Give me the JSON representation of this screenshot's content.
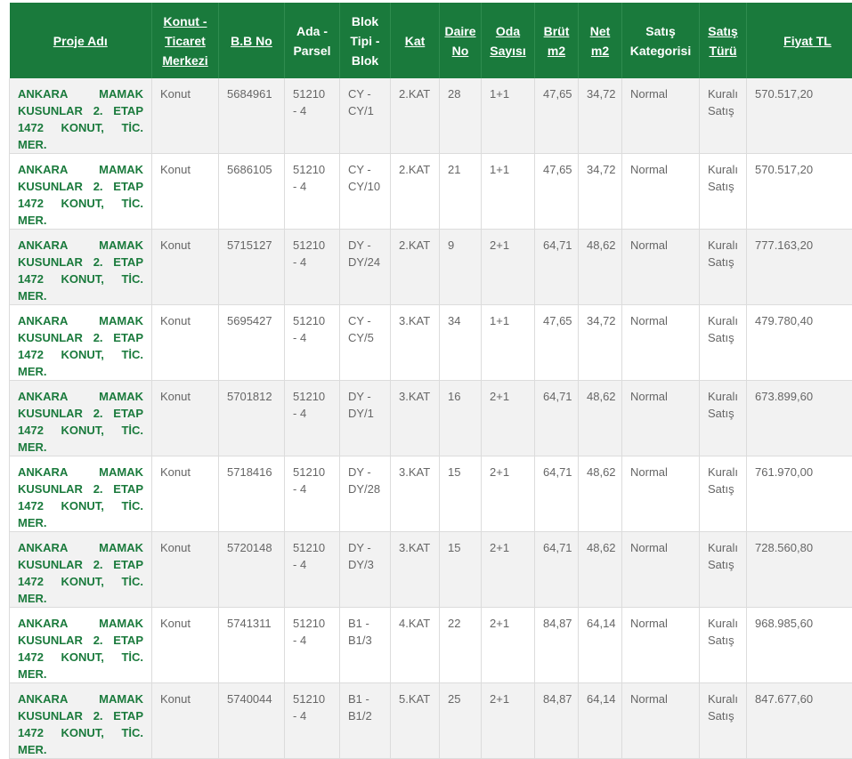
{
  "table": {
    "headers": [
      {
        "key": "proje",
        "label": "Proje Adı",
        "sortable": true
      },
      {
        "key": "konut",
        "label": "Konut - Ticaret Merkezi",
        "sortable": true
      },
      {
        "key": "bb",
        "label": "B.B No",
        "sortable": true
      },
      {
        "key": "ada",
        "label": "Ada - Parsel",
        "sortable": false
      },
      {
        "key": "blok",
        "label": "Blok Tipi - Blok",
        "sortable": false
      },
      {
        "key": "kat",
        "label": "Kat",
        "sortable": true
      },
      {
        "key": "daire",
        "label": "Daire No",
        "sortable": true
      },
      {
        "key": "oda",
        "label": "Oda Sayısı",
        "sortable": true
      },
      {
        "key": "brut",
        "label": "Brüt m2",
        "sortable": true
      },
      {
        "key": "net",
        "label": "Net m2",
        "sortable": true
      },
      {
        "key": "kategori",
        "label": "Satış Kategorisi",
        "sortable": false
      },
      {
        "key": "tur",
        "label": "Satış Türü",
        "sortable": true
      },
      {
        "key": "fiyat",
        "label": "Fiyat TL",
        "sortable": true
      }
    ],
    "rows": [
      {
        "proje": "ANKARA MAMAK KUSUNLAR 2. ETAP 1472 KONUT, TİC. MER.",
        "konut": "Konut",
        "bb": "5684961",
        "ada": "51210 - 4",
        "blok": "CY - CY/1",
        "kat": "2.KAT",
        "daire": "28",
        "oda": "1+1",
        "brut": "47,65",
        "net": "34,72",
        "kategori": "Normal",
        "tur": "Kuralı Satış",
        "fiyat": "570.517,20"
      },
      {
        "proje": "ANKARA MAMAK KUSUNLAR 2. ETAP 1472 KONUT, TİC. MER.",
        "konut": "Konut",
        "bb": "5686105",
        "ada": "51210 - 4",
        "blok": "CY - CY/10",
        "kat": "2.KAT",
        "daire": "21",
        "oda": "1+1",
        "brut": "47,65",
        "net": "34,72",
        "kategori": "Normal",
        "tur": "Kuralı Satış",
        "fiyat": "570.517,20"
      },
      {
        "proje": "ANKARA MAMAK KUSUNLAR 2. ETAP 1472 KONUT, TİC. MER.",
        "konut": "Konut",
        "bb": "5715127",
        "ada": "51210 - 4",
        "blok": "DY - DY/24",
        "kat": "2.KAT",
        "daire": "9",
        "oda": "2+1",
        "brut": "64,71",
        "net": "48,62",
        "kategori": "Normal",
        "tur": "Kuralı Satış",
        "fiyat": "777.163,20"
      },
      {
        "proje": "ANKARA MAMAK KUSUNLAR 2. ETAP 1472 KONUT, TİC. MER.",
        "konut": "Konut",
        "bb": "5695427",
        "ada": "51210 - 4",
        "blok": "CY - CY/5",
        "kat": "3.KAT",
        "daire": "34",
        "oda": "1+1",
        "brut": "47,65",
        "net": "34,72",
        "kategori": "Normal",
        "tur": "Kuralı Satış",
        "fiyat": "479.780,40"
      },
      {
        "proje": "ANKARA MAMAK KUSUNLAR 2. ETAP 1472 KONUT, TİC. MER.",
        "konut": "Konut",
        "bb": "5701812",
        "ada": "51210 - 4",
        "blok": "DY - DY/1",
        "kat": "3.KAT",
        "daire": "16",
        "oda": "2+1",
        "brut": "64,71",
        "net": "48,62",
        "kategori": "Normal",
        "tur": "Kuralı Satış",
        "fiyat": "673.899,60"
      },
      {
        "proje": "ANKARA MAMAK KUSUNLAR 2. ETAP 1472 KONUT, TİC. MER.",
        "konut": "Konut",
        "bb": "5718416",
        "ada": "51210 - 4",
        "blok": "DY - DY/28",
        "kat": "3.KAT",
        "daire": "15",
        "oda": "2+1",
        "brut": "64,71",
        "net": "48,62",
        "kategori": "Normal",
        "tur": "Kuralı Satış",
        "fiyat": "761.970,00"
      },
      {
        "proje": "ANKARA MAMAK KUSUNLAR 2. ETAP 1472 KONUT, TİC. MER.",
        "konut": "Konut",
        "bb": "5720148",
        "ada": "51210 - 4",
        "blok": "DY - DY/3",
        "kat": "3.KAT",
        "daire": "15",
        "oda": "2+1",
        "brut": "64,71",
        "net": "48,62",
        "kategori": "Normal",
        "tur": "Kuralı Satış",
        "fiyat": "728.560,80"
      },
      {
        "proje": "ANKARA MAMAK KUSUNLAR 2. ETAP 1472 KONUT, TİC. MER.",
        "konut": "Konut",
        "bb": "5741311",
        "ada": "51210 - 4",
        "blok": "B1 - B1/3",
        "kat": "4.KAT",
        "daire": "22",
        "oda": "2+1",
        "brut": "84,87",
        "net": "64,14",
        "kategori": "Normal",
        "tur": "Kuralı Satış",
        "fiyat": "968.985,60"
      },
      {
        "proje": "ANKARA MAMAK KUSUNLAR 2. ETAP 1472 KONUT, TİC. MER.",
        "konut": "Konut",
        "bb": "5740044",
        "ada": "51210 - 4",
        "blok": "B1 - B1/2",
        "kat": "5.KAT",
        "daire": "25",
        "oda": "2+1",
        "brut": "84,87",
        "net": "64,14",
        "kategori": "Normal",
        "tur": "Kuralı Satış",
        "fiyat": "847.677,60"
      }
    ]
  },
  "colors": {
    "header_bg": "#1a7a3c",
    "project_text": "#1a7a3c",
    "cell_text": "#666666",
    "row_alt": "#f2f2f2"
  }
}
